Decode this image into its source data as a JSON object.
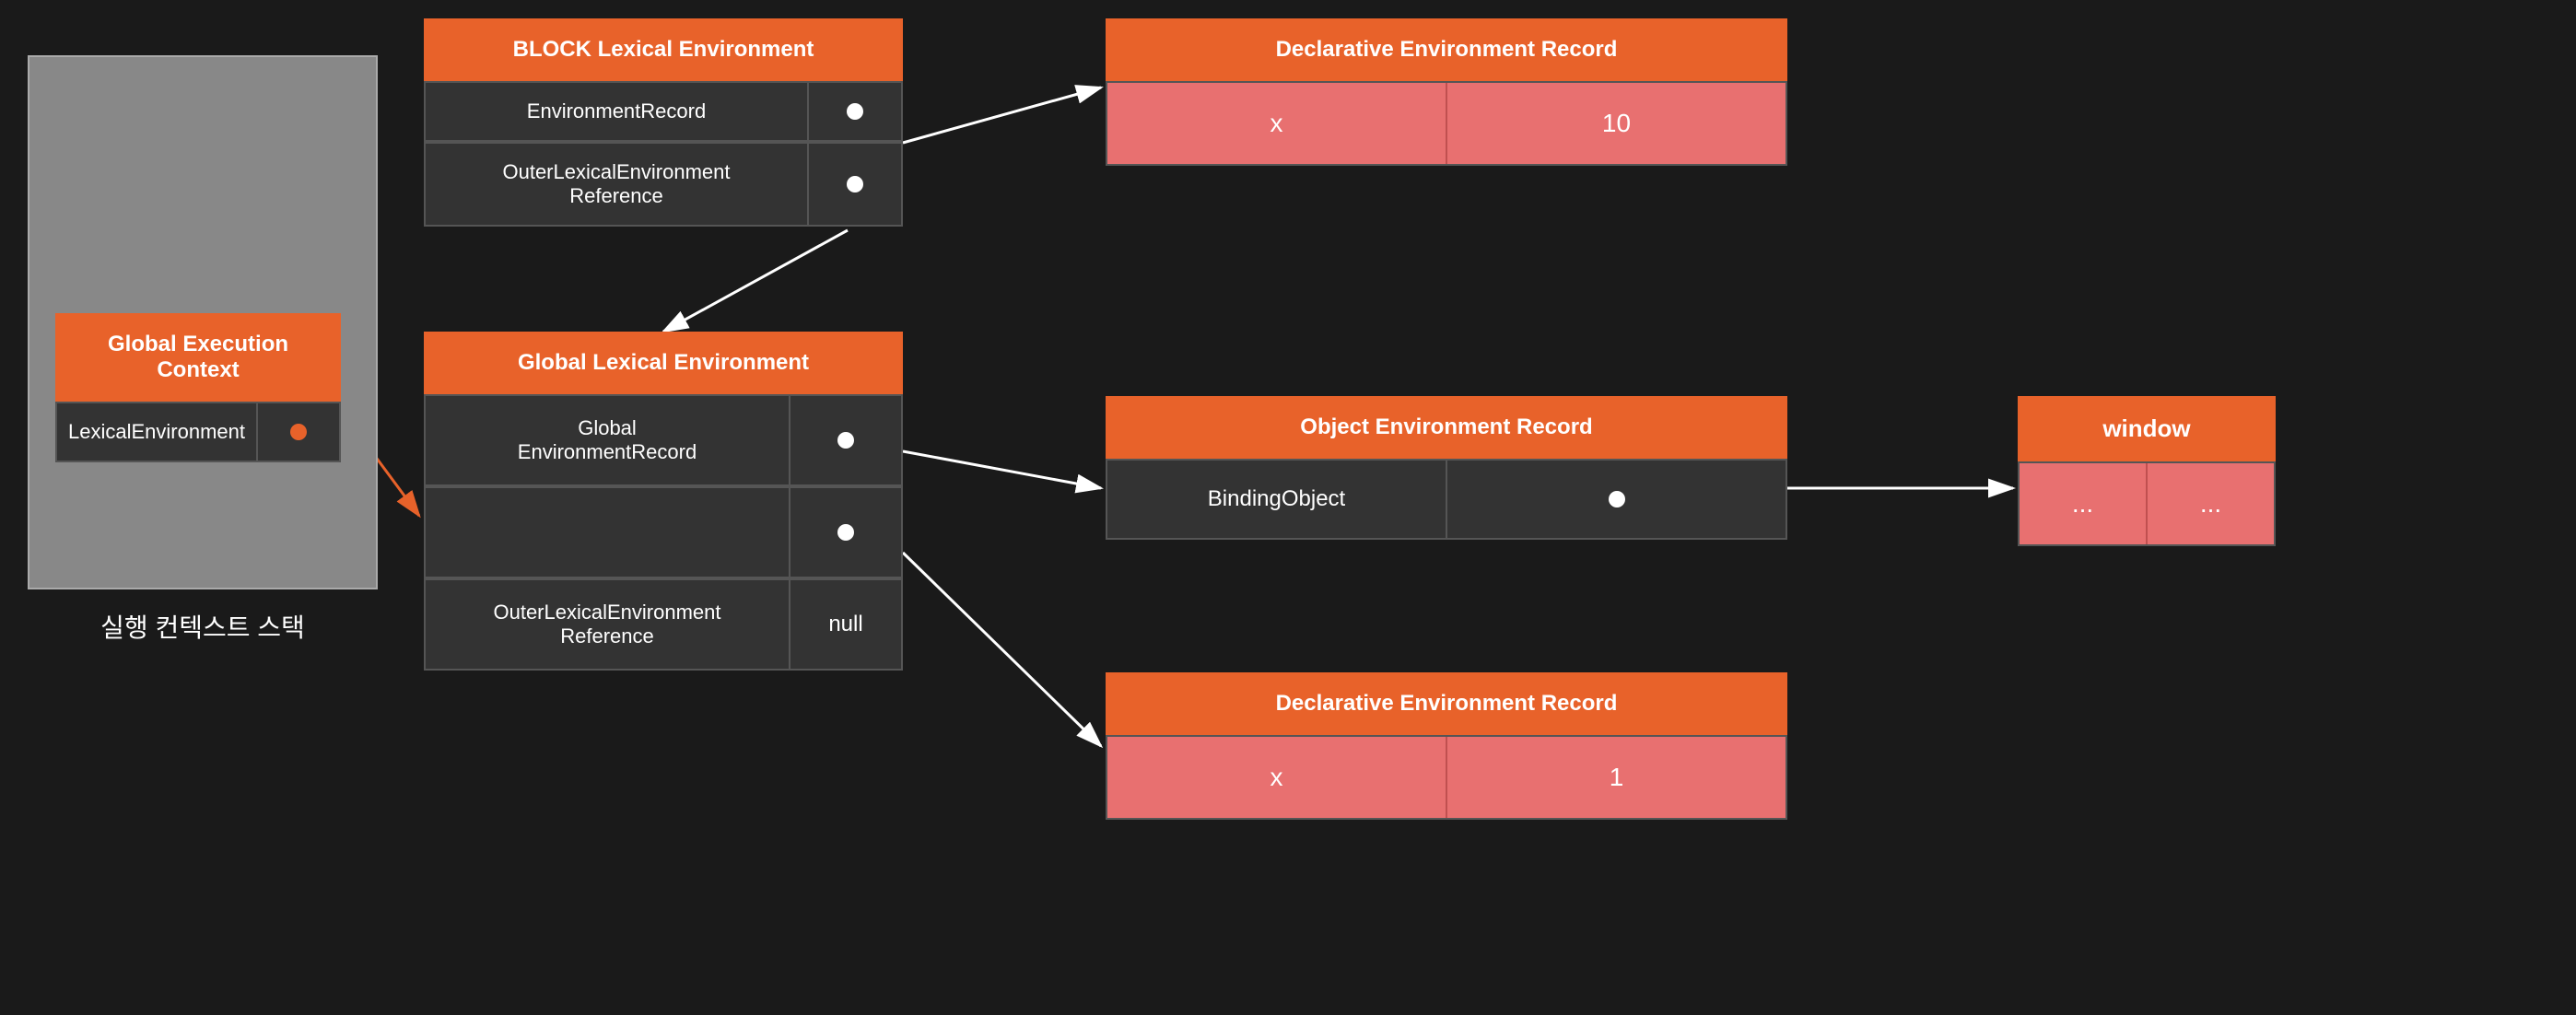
{
  "execStack": {
    "label": "실행 컨텍스트 스택",
    "globalContext": {
      "header": "Global Execution Context",
      "row1Left": "LexicalEnvironment",
      "row1Right": "dot"
    }
  },
  "blockLexEnv": {
    "header": "BLOCK Lexical Environment",
    "row1Left": "EnvironmentRecord",
    "row2Left": "OuterLexicalEnvironment\nReference"
  },
  "globalLexEnv": {
    "header": "Global Lexical Environment",
    "row1Left": "Global\nEnvironmentRecord",
    "row2Left": "OuterLexicalEnvironment\nReference",
    "row2Right": "null"
  },
  "declEnvRecordTop": {
    "header": "Declarative Environment Record",
    "col1": "x",
    "col2": "10"
  },
  "objEnvRecord": {
    "header": "Object Environment Record",
    "col1": "BindingObject",
    "col2": "dot"
  },
  "declEnvRecordBottom": {
    "header": "Declarative Environment Record",
    "col1": "x",
    "col2": "1"
  },
  "windowBox": {
    "header": "window",
    "col1": "...",
    "col2": "..."
  }
}
